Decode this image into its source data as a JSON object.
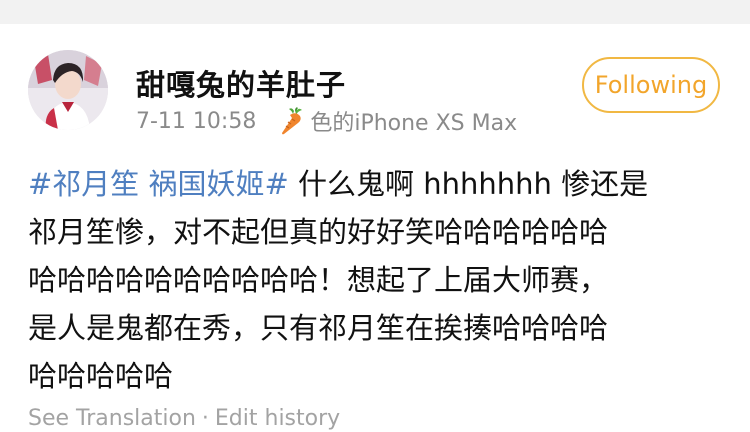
{
  "post": {
    "author": {
      "name": "甜嘎兔的羊肚子",
      "follow_label": "Following"
    },
    "meta": {
      "time": "7-11 10:58",
      "device": "色的iPhone XS Max",
      "device_icon": "carrot-icon"
    },
    "content": {
      "hashtag": "#祁月笙 祸国妖姬#",
      "line1_rest": " 什么鬼啊 hhhhhhh 惨还是",
      "line2": "祁月笙惨，对不起但真的好好笑哈哈哈哈哈哈",
      "line3": "哈哈哈哈哈哈哈哈哈哈！想起了上届大师赛，",
      "line4": "是人是鬼都在秀，只有祁月笙在挨揍哈哈哈哈",
      "line5": "哈哈哈哈哈"
    },
    "footer": {
      "translate": "See Translation",
      "separator": "·",
      "history": "Edit history"
    }
  },
  "colors": {
    "hashtag": "#4f7fc0",
    "follow": "#f2a52b",
    "meta": "#8a8a8a"
  }
}
